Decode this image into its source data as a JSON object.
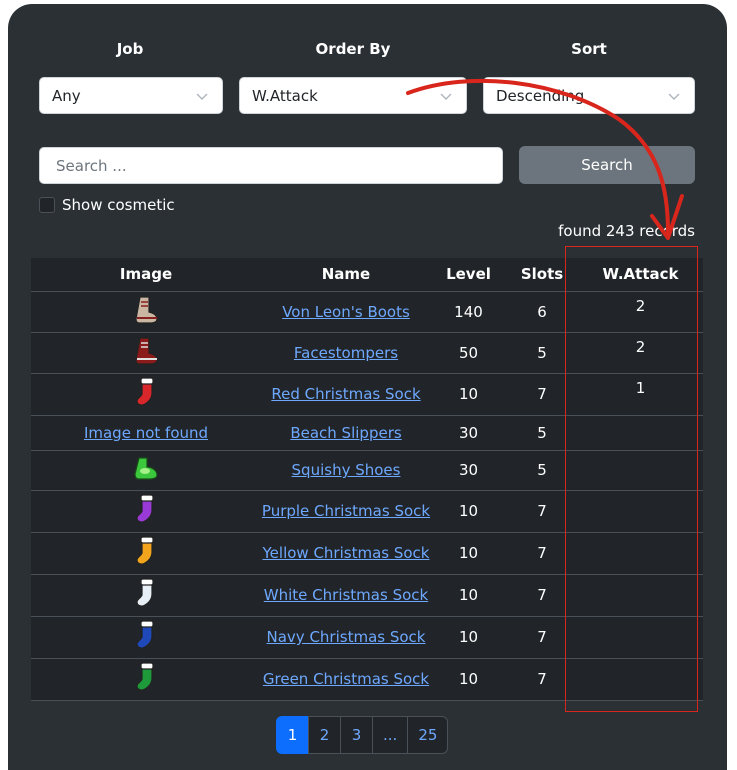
{
  "filters": {
    "job_label": "Job",
    "order_label": "Order By",
    "sort_label": "Sort",
    "job_value": "Any",
    "order_value": "W.Attack",
    "sort_value": "Descending"
  },
  "search": {
    "placeholder": "Search ...",
    "button_label": "Search",
    "show_cosmetic_label": "Show cosmetic"
  },
  "results": {
    "found_text": "found 243 records"
  },
  "table": {
    "columns": [
      "Image",
      "Name",
      "Level",
      "Slots",
      "W.Attack"
    ],
    "rows": [
      {
        "name": "Von Leon's Boots",
        "level": "140",
        "slots": "6",
        "watk": "2",
        "icon": "boots-icon",
        "color": "#c9b7a4",
        "accent": "#8a1f1f"
      },
      {
        "name": "Facestompers",
        "level": "50",
        "slots": "5",
        "watk": "2",
        "icon": "boots-icon",
        "color": "#8b1a1a",
        "accent": "#e0e0e0"
      },
      {
        "name": "Red Christmas Sock",
        "level": "10",
        "slots": "7",
        "watk": "1",
        "icon": "sock-icon",
        "color": "#d8262b",
        "accent": "#ffffff"
      },
      {
        "name": "Beach Slippers",
        "level": "30",
        "slots": "5",
        "watk": "",
        "icon": "broken-image",
        "color": "",
        "accent": ""
      },
      {
        "name": "Squishy Shoes",
        "level": "30",
        "slots": "5",
        "watk": "",
        "icon": "shoes-icon",
        "color": "#3cc83c",
        "accent": "#a6f08a"
      },
      {
        "name": "Purple Christmas Sock",
        "level": "10",
        "slots": "7",
        "watk": "",
        "icon": "sock-icon",
        "color": "#9a3ad6",
        "accent": "#ffffff"
      },
      {
        "name": "Yellow Christmas Sock",
        "level": "10",
        "slots": "7",
        "watk": "",
        "icon": "sock-icon",
        "color": "#f2a51c",
        "accent": "#ffffff"
      },
      {
        "name": "White Christmas Sock",
        "level": "10",
        "slots": "7",
        "watk": "",
        "icon": "sock-icon",
        "color": "#e8eef5",
        "accent": "#ffffff"
      },
      {
        "name": "Navy Christmas Sock",
        "level": "10",
        "slots": "7",
        "watk": "",
        "icon": "sock-icon",
        "color": "#1f48b8",
        "accent": "#ffffff"
      },
      {
        "name": "Green Christmas Sock",
        "level": "10",
        "slots": "7",
        "watk": "",
        "icon": "sock-icon",
        "color": "#1e9a3a",
        "accent": "#ffffff"
      }
    ],
    "broken_image_alt": "Image not found"
  },
  "pagination": {
    "pages": [
      "1",
      "2",
      "3",
      "...",
      "25"
    ],
    "active": "1"
  }
}
